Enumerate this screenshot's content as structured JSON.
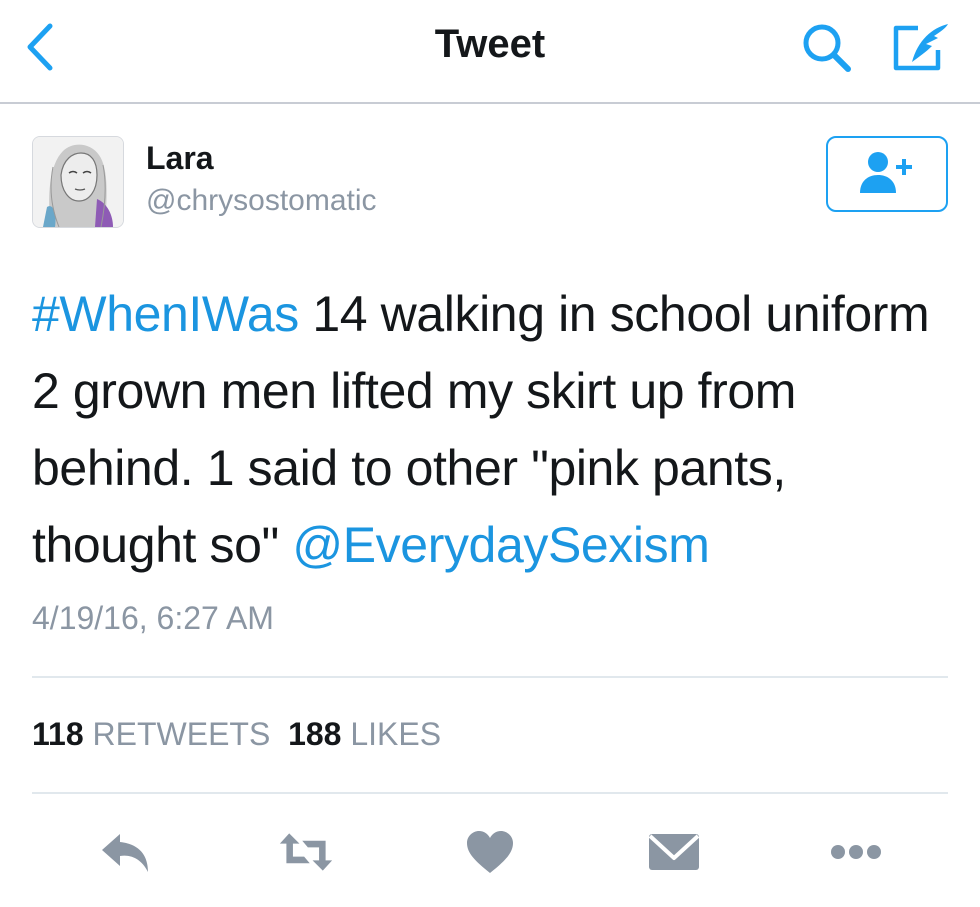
{
  "navbar": {
    "title": "Tweet",
    "icons": [
      "back-chevron-icon",
      "search-icon",
      "compose-icon"
    ]
  },
  "user": {
    "name": "Lara",
    "handle": "@chrysostomatic"
  },
  "follow_button": {
    "icon": "follow-user-icon"
  },
  "tweet": {
    "hashtag": "#WhenIWas",
    "body": " 14 walking in school uniform 2 grown men lifted my skirt up from behind. 1 said to other \"pink pants, thought so\" ",
    "mention": "@EverydaySexism",
    "timestamp": "4/19/16, 6:27 AM"
  },
  "stats": {
    "retweets_count": "118",
    "retweets_label": "RETWEETS",
    "likes_count": "188",
    "likes_label": "LIKES"
  },
  "actions": [
    "reply-icon",
    "retweet-icon",
    "like-icon",
    "direct-message-icon",
    "more-icon"
  ],
  "colors": {
    "accent": "#1da1f2",
    "link": "#1b95e0",
    "text": "#14171a",
    "secondary_text": "#8b96a3",
    "action_icon": "#8b96a3",
    "divider": "#e1e8ed"
  }
}
